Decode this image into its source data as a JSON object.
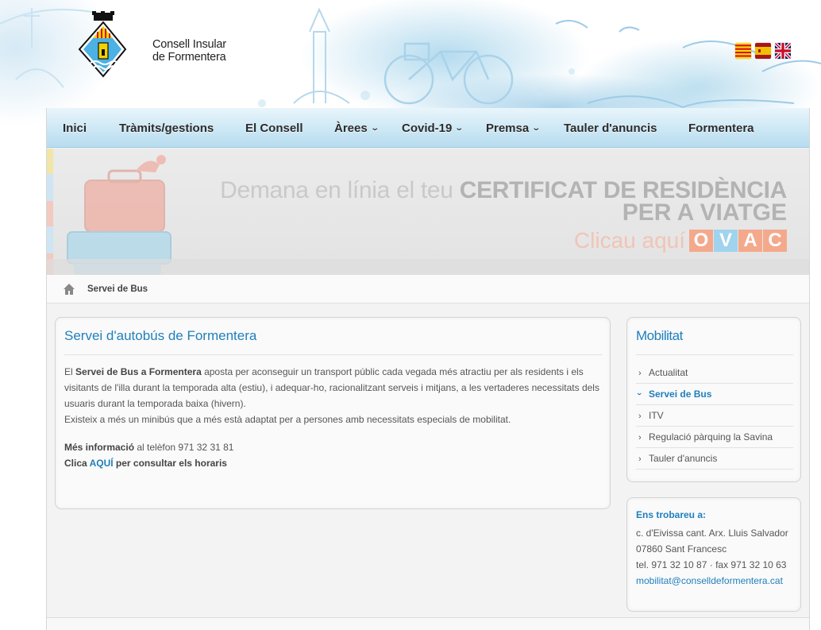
{
  "brand": {
    "line1": "Consell Insular",
    "line2": "de Formentera"
  },
  "languages": [
    {
      "icon": "catalan-flag-icon",
      "colors": [
        "#fcdd09",
        "#da121a"
      ]
    },
    {
      "icon": "spanish-flag-icon",
      "colors": [
        "#aa151b",
        "#f1bf00"
      ]
    },
    {
      "icon": "uk-flag-icon",
      "colors": [
        "#012169",
        "#c8102e",
        "#ffffff"
      ]
    }
  ],
  "nav": [
    {
      "label": "Inici",
      "dropdown": false
    },
    {
      "label": "Tràmits/gestions",
      "dropdown": false
    },
    {
      "label": "El Consell",
      "dropdown": false
    },
    {
      "label": "Àrees",
      "dropdown": true
    },
    {
      "label": "Covid-19",
      "dropdown": true
    },
    {
      "label": "Premsa",
      "dropdown": true
    },
    {
      "label": "Tauler d'anuncis",
      "dropdown": false
    },
    {
      "label": "Formentera",
      "dropdown": false
    }
  ],
  "banner": {
    "line1_prefix": "Demana en línia el teu ",
    "line1_bold": "CERTIFICAT DE RESIDÈNCIA",
    "line2": "PER A VIATGE",
    "line3": "Clicau aquí",
    "ovac": [
      "O",
      "V",
      "A",
      "C"
    ],
    "ovac_colors": [
      "#f4a98c",
      "#9fd3ee",
      "#f4a98c",
      "#f4a98c"
    ]
  },
  "breadcrumb": {
    "current": "Servei de Bus"
  },
  "main": {
    "title": "Servei d'autobús de Formentera",
    "p1_a": "El ",
    "p1_bold": "Servei de Bus a Formentera",
    "p1_b": " aposta per aconseguir un transport públic cada vegada més atractiu per als residents i els visitants de l'illa durant la temporada alta (estiu), i adequar-ho, racionalitzant serveis i mitjans, a les vertaderes necessitats dels usuaris durant la temporada baixa (hivern).",
    "p2": "Existeix a més un minibús que a més està adaptat per a persones amb necessitats especials de mobilitat.",
    "info_bold": "Més informació",
    "info_rest": " al telèfon 971 32 31 81",
    "link_prefix": "Clica ",
    "link_label": "AQUÍ",
    "link_suffix": " per consultar els horaris"
  },
  "sidebar": {
    "title": "Mobilitat",
    "items": [
      {
        "label": "Actualitat"
      },
      {
        "label": "Servei de Bus"
      },
      {
        "label": "ITV"
      },
      {
        "label": "Regulació pàrquing la Savina"
      },
      {
        "label": "Tauler d'anuncis"
      }
    ],
    "active_index": 1
  },
  "contact": {
    "heading": "Ens trobareu a:",
    "address1": "c. d'Eivissa cant. Arx. Lluis Salvador",
    "address2": "07860 Sant Francesc",
    "phone": "tel. 971 32 10 87 · fax 971 32 10 63",
    "email": "mobilitat@conselldeformentera.cat"
  },
  "colors": {
    "accent": "#1f7fbd",
    "nav_top": "#e9f5fb",
    "nav_bottom": "#b7dcef"
  }
}
